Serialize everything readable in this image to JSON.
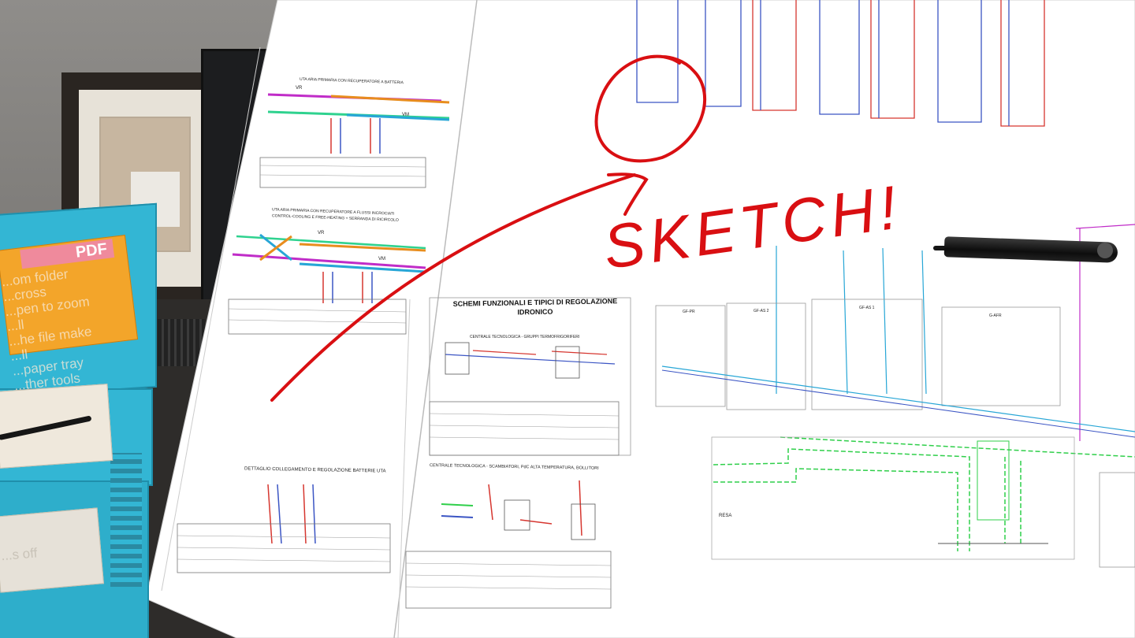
{
  "tray": {
    "pdf_label": "PDF",
    "pdf_hint": "...om folder\n...cross\n...pen to zoom\n...ll\n...he file make\n...ll\n...paper tray\n...ther tools",
    "off_hint": "...s off"
  },
  "drawing": {
    "uta1": "UTA ARIA PRIMARIA CON RECUPERATORE A BATTERIA",
    "uta2": "UTA ARIA PRIMARIA CON RECUPERATORE A FLUSSI INCROCIATI",
    "uta2b": "CONTROL-COOLING E FREE-HEATING + SERRANDA DI RICIRCOLO",
    "vr": "VR",
    "vm": "VM",
    "detail": "DETTAGLIO COLLEGAMENTO E REGOLAZIONE BATTERIE UTA",
    "title_line1": "SCHEMI FUNZIONALI E TIPICI DI REGOLAZIONE",
    "title_line2": "IDRONICO",
    "central1": "CENTRALE TECNOLOGICA - GRUPPI TERMOFRIGORIFERI",
    "central2": "CENTRALE TECNOLOGICA - SCAMBIATORI, PdC ALTA TEMPERATURA, BOLLITORI",
    "resa": "RESA",
    "gf_labels": [
      "GF-PR",
      "GF-AS 2",
      "GF-AS 1",
      "G-AFR"
    ]
  },
  "annotation": {
    "word": "SKETCH!",
    "color": "#d90f12"
  },
  "colors": {
    "tray": "#33b6d4",
    "pdf_card": "#f3a52a",
    "pdf_tag": "#ef8a9c",
    "pipe_red": "#d6362f",
    "pipe_blue": "#3b55c4",
    "pipe_cyan": "#27a6d6",
    "pipe_green": "#2fcf4a",
    "pipe_orange": "#e88d1e",
    "pipe_magenta": "#c02cc8"
  }
}
